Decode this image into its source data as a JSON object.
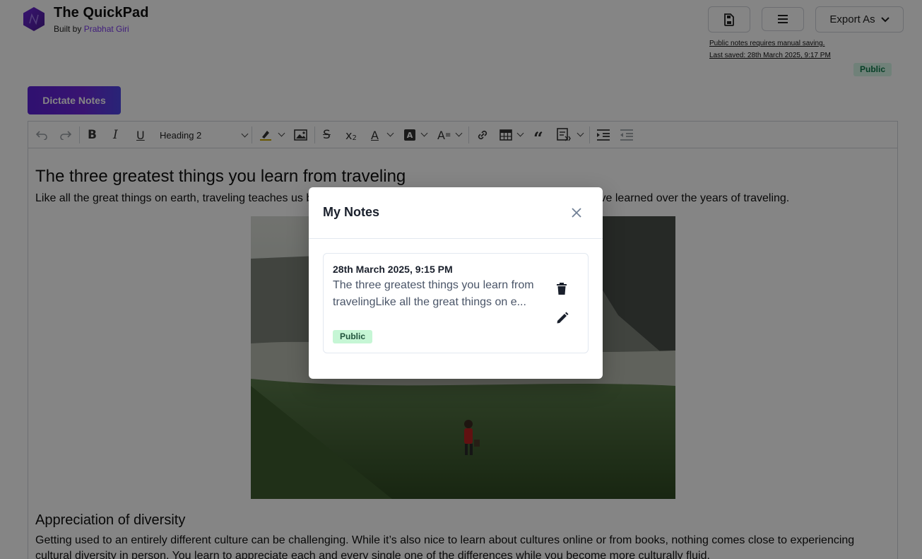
{
  "header": {
    "app_title": "The QuickPad",
    "built_by_prefix": "Built by ",
    "author": "Prabhat Giri",
    "export_label": "Export As",
    "save_note_1": "Public notes requires manual saving.",
    "save_note_2": "Last saved: 28th March 2025, 9:17 PM",
    "visibility_badge": "Public"
  },
  "dictate_label": "Dictate Notes",
  "toolbar": {
    "heading_value": "Heading 2",
    "icons": [
      "undo-icon",
      "redo-icon",
      "bold-icon",
      "italic-icon",
      "underline-icon",
      "highlight-icon",
      "image-icon",
      "strikethrough-icon",
      "subscript-icon",
      "font-color-icon",
      "background-color-icon",
      "font-size-icon",
      "link-icon",
      "table-icon",
      "blockquote-icon",
      "html-embed-icon",
      "indent-icon",
      "outdent-icon"
    ]
  },
  "document": {
    "title": "The three greatest things you learn from traveling",
    "intro": "Like all the great things on earth, traveling teaches us by example. Here are some of the most precious lessons I’ve learned over the years of traveling.",
    "section_heading": "Appreciation of diversity",
    "section_body": "Getting used to an entirely different culture can be challenging. While it’s also nice to learn about cultures online or from books, nothing comes close to experiencing cultural diversity in person. You learn to appreciate each and every single one of the differences while you become more culturally fluid."
  },
  "modal": {
    "title": "My Notes",
    "notes": [
      {
        "date": "28th March 2025, 9:15 PM",
        "preview": "The three greatest things you learn from travelingLike all the great things on e...",
        "badge": "Public"
      }
    ]
  },
  "colors": {
    "accent": "#6d28d9",
    "public_badge_bg": "#c6f6d5",
    "public_badge_text": "#22543d"
  }
}
